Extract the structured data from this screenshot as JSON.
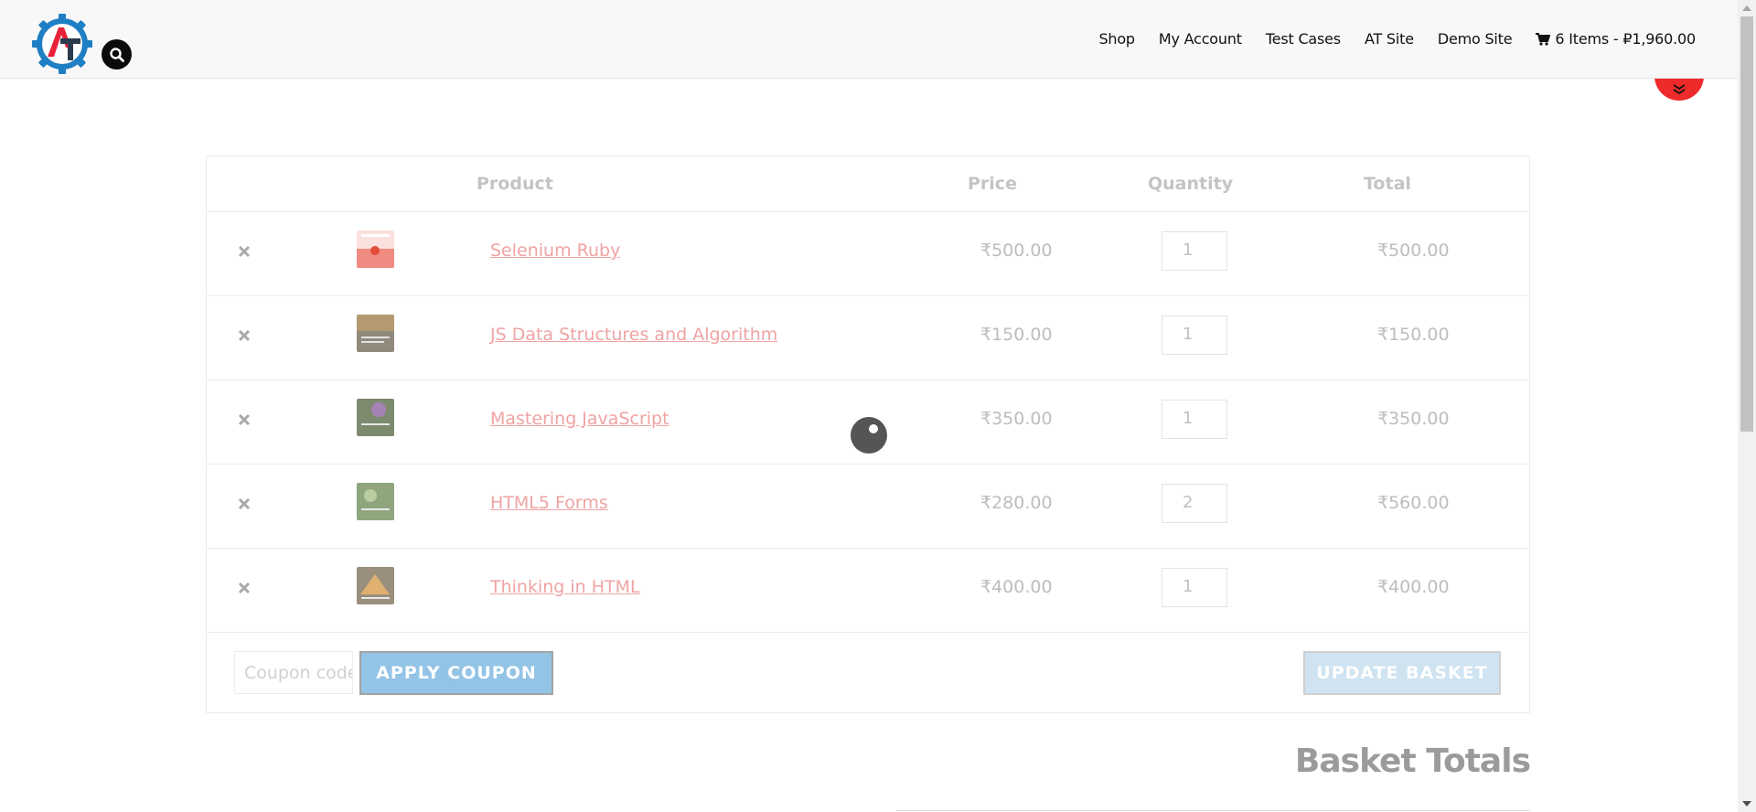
{
  "header": {
    "nav": [
      "Shop",
      "My Account",
      "Test Cases",
      "AT Site",
      "Demo Site"
    ],
    "cart_label": "6 Items - ₽1,960.00"
  },
  "table": {
    "headers": {
      "product": "Product",
      "price": "Price",
      "quantity": "Quantity",
      "total": "Total"
    },
    "rows": [
      {
        "name": "Selenium Ruby",
        "price": "₹500.00",
        "qty": "1",
        "total": "₹500.00"
      },
      {
        "name": "JS Data Structures and Algorithm",
        "price": "₹150.00",
        "qty": "1",
        "total": "₹150.00"
      },
      {
        "name": "Mastering JavaScript",
        "price": "₹350.00",
        "qty": "1",
        "total": "₹350.00"
      },
      {
        "name": "HTML5 Forms",
        "price": "₹280.00",
        "qty": "2",
        "total": "₹560.00"
      },
      {
        "name": "Thinking in HTML",
        "price": "₹400.00",
        "qty": "1",
        "total": "₹400.00"
      }
    ]
  },
  "coupon": {
    "placeholder": "Coupon code",
    "apply_label": "APPLY COUPON"
  },
  "update_label": "UPDATE BASKET",
  "basket_totals_heading": "Basket Totals",
  "colors": {
    "accent_red": "#ee2a2a",
    "logo_blue": "#1e7fc5",
    "apply_blue": "#93c4e6"
  },
  "icons": {
    "logo": "automation-testing-gear-logo",
    "search": "search-icon",
    "cart": "shopping-cart-icon",
    "scroll_down": "double-chevron-down-icon",
    "remove": "close-icon",
    "loader": "loading-spinner-icon"
  }
}
